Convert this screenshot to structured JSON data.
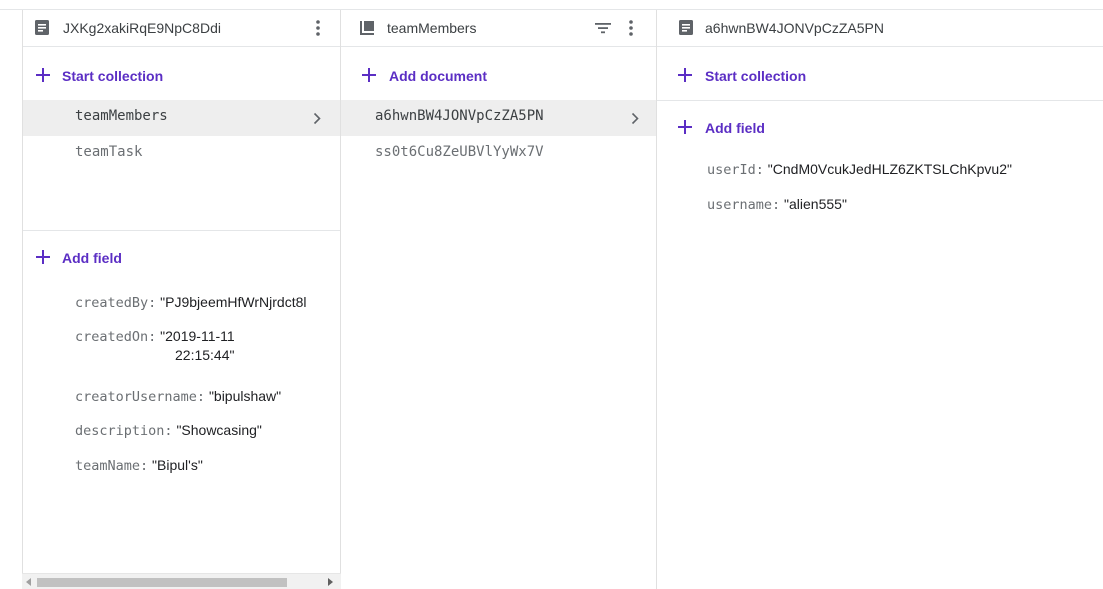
{
  "columns": {
    "root_doc": {
      "title": "JXKg2xakiRqE9NpC8Ddi",
      "start_collection_label": "Start collection",
      "collections": [
        "teamMembers",
        "teamTask"
      ],
      "add_field_label": "Add field",
      "fields": [
        {
          "key": "createdBy:",
          "value": "\"PJ9bjeemHfWrNjrdct8l"
        },
        {
          "key": "createdOn:",
          "value": "\"2019-11-11",
          "value_line2": "22:15:44\""
        },
        {
          "key": "creatorUsername:",
          "value": "\"bipulshaw\""
        },
        {
          "key": "description:",
          "value": "\"Showcasing\""
        },
        {
          "key": "teamName:",
          "value": "\"Bipul's\""
        }
      ]
    },
    "collection": {
      "title": "teamMembers",
      "add_document_label": "Add document",
      "documents": [
        "a6hwnBW4JONVpCzZA5PN",
        "ss0t6Cu8ZeUBVlYyWx7V"
      ]
    },
    "document": {
      "title": "a6hwnBW4JONVpCzZA5PN",
      "start_collection_label": "Start collection",
      "add_field_label": "Add field",
      "fields": [
        {
          "key": "userId:",
          "value": "\"CndM0VcukJedHLZ6ZKTSLChKpvu2\""
        },
        {
          "key": "username:",
          "value": "\"alien555\""
        }
      ]
    }
  },
  "icons": {
    "doc": "document-icon",
    "collection": "collection-icon",
    "plus": "plus-icon",
    "chevron": "chevron-right-icon",
    "menu": "more-vert-icon",
    "filter": "filter-icon"
  },
  "colors": {
    "accent": "#5b2ec4",
    "icon_gray": "#5f6368",
    "selected_bg": "#eeeeee"
  }
}
